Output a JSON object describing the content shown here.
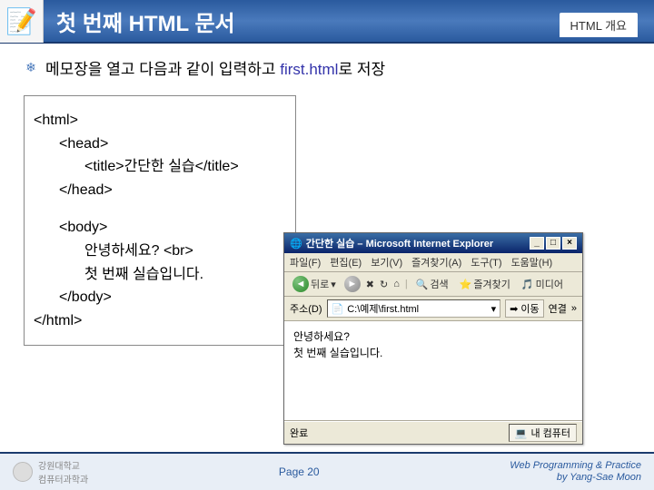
{
  "header": {
    "title": "첫 번째 HTML 문서",
    "subtitle": "HTML 개요"
  },
  "bullet": {
    "text_pre": "메모장을 열고 다음과 같이 입력하고 ",
    "filename": "first.html",
    "text_post": "로 저장"
  },
  "code": {
    "l1": "<html>",
    "l2": "<head>",
    "l3": "<title>간단한 실습</title>",
    "l4": "</head>",
    "l5": "<body>",
    "l6": "안녕하세요? <br>",
    "l7": "첫 번째 실습입니다.",
    "l8": "</body>",
    "l9": "</html>"
  },
  "ie": {
    "title": "간단한 실습 – Microsoft Internet Explorer",
    "menu": {
      "file": "파일(F)",
      "edit": "편집(E)",
      "view": "보기(V)",
      "fav": "즐겨찾기(A)",
      "tools": "도구(T)",
      "help": "도움말(H)"
    },
    "toolbar": {
      "back": "뒤로",
      "search": "검색",
      "fav": "즐겨찾기",
      "media": "미디어"
    },
    "address": {
      "label": "주소(D)",
      "value": "C:\\예제\\first.html",
      "go": "이동",
      "links": "연결"
    },
    "page": {
      "line1": "안녕하세요?",
      "line2": "첫 번째 실습입니다."
    },
    "status": {
      "left": "완료",
      "right": "내 컴퓨터"
    }
  },
  "footer": {
    "logo_text": "강원대학교\n컴퓨터과학과",
    "page": "Page 20",
    "credit1": "Web Programming & Practice",
    "credit2": "by Yang-Sae Moon"
  }
}
